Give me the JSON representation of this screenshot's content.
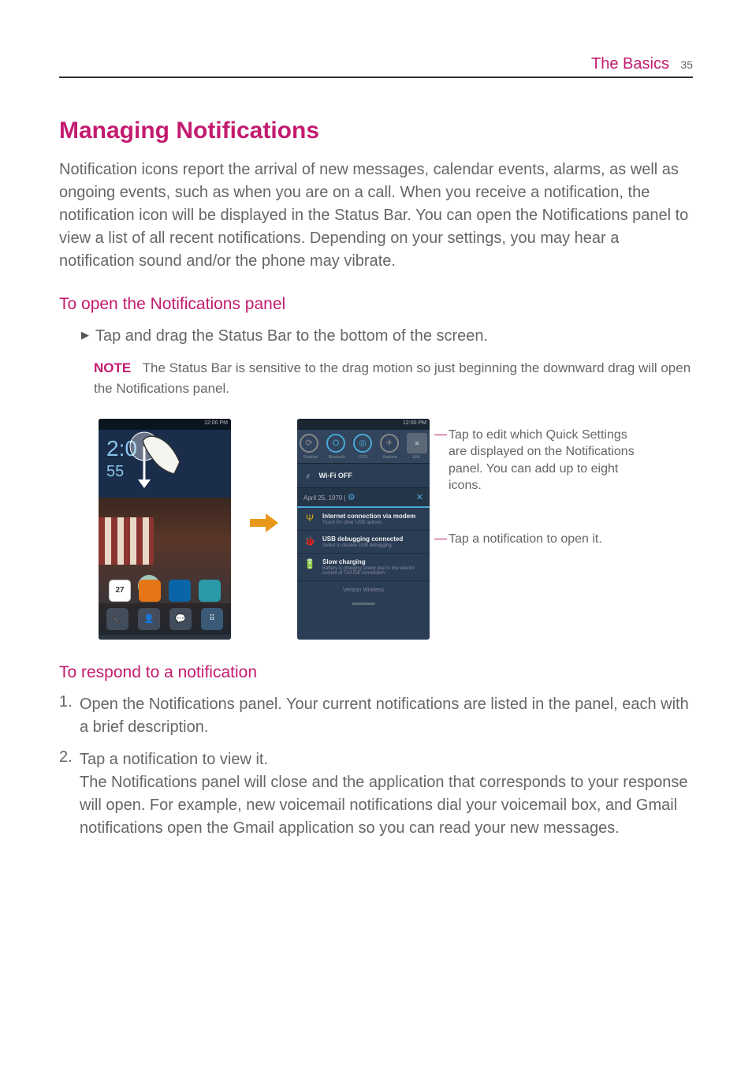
{
  "header": {
    "section": "The Basics",
    "page_number": "35"
  },
  "title": "Managing Notifications",
  "intro_text": "Notification icons report the arrival of new messages, calendar events, alarms, as well as ongoing events, such as when you are on a call. When you receive a notification, the notification icon will be displayed in the Status Bar. You can open the Notifications panel to view a list of all recent notifications. Depending on your settings, you may hear a notification sound and/or the phone may vibrate.",
  "section_open": {
    "heading": "To open the Notifications panel",
    "bullet": "Tap and drag the Status Bar to the bottom of the screen.",
    "note_label": "NOTE",
    "note_text": "The Status Bar is sensitive to the drag motion so just beginning the downward drag will open the Notifications panel."
  },
  "figure": {
    "home_screen": {
      "status_time": "12:00 PM",
      "clock": "2:0",
      "temp": "55",
      "calendar_day": "27"
    },
    "notif_panel": {
      "status_time": "12:00 PM",
      "qs_labels": [
        "Rotation",
        "Bluetooth",
        "GPS",
        "Airplane",
        "Edit"
      ],
      "wifi_label": "Wi-Fi OFF",
      "date_label": "April 25, 1970",
      "notifications": [
        {
          "title": "Internet connection via modem",
          "sub": "Touch for other USB options"
        },
        {
          "title": "USB debugging connected",
          "sub": "Select to disable USB debugging"
        },
        {
          "title": "Slow charging",
          "sub": "Battery is charging slowly due to low electric current of TA/USB connection."
        }
      ],
      "carrier": "Verizon Wireless"
    },
    "callout_edit": "Tap to edit which Quick Settings are displayed on the Notifications panel. You can add up to eight icons.",
    "callout_open": "Tap a notification to open it."
  },
  "section_respond": {
    "heading": "To respond to a notification",
    "step1": "Open the Notifications panel. Your current notifications are listed in the panel, each with a brief description.",
    "step2a": "Tap a notification to view it.",
    "step2b": "The Notifications panel will close and the application that corresponds to your response will open. For example, new voicemail notifications dial your voicemail box, and Gmail notifications open the Gmail application so you can read your new messages."
  }
}
